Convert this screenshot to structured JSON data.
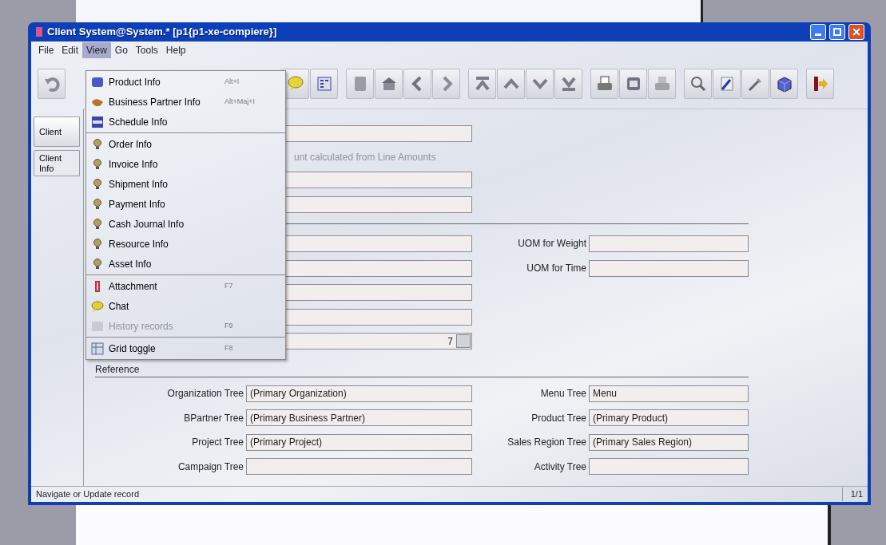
{
  "window": {
    "title": "Client  System@System.* [p1{p1-xe-compiere}]"
  },
  "menu_bar": [
    {
      "label": "File",
      "selected": false
    },
    {
      "label": "Edit",
      "selected": false
    },
    {
      "label": "View",
      "selected": true
    },
    {
      "label": "Go",
      "selected": false
    },
    {
      "label": "Tools",
      "selected": false
    },
    {
      "label": "Help",
      "selected": false
    }
  ],
  "view_menu": [
    {
      "kind": "item",
      "label": "Product Info",
      "shortcut": "Alt+I",
      "disabled": false
    },
    {
      "kind": "item",
      "label": "Business Partner Info",
      "shortcut": "Alt+Maj+I",
      "disabled": false
    },
    {
      "kind": "item",
      "label": "Schedule Info",
      "disabled": false
    },
    {
      "kind": "separator"
    },
    {
      "kind": "item",
      "label": "Order Info",
      "disabled": false
    },
    {
      "kind": "item",
      "label": "Invoice Info",
      "disabled": false
    },
    {
      "kind": "item",
      "label": "Shipment Info",
      "disabled": false
    },
    {
      "kind": "item",
      "label": "Payment Info",
      "disabled": false
    },
    {
      "kind": "item",
      "label": "Cash Journal Info",
      "disabled": false
    },
    {
      "kind": "item",
      "label": "Resource Info",
      "disabled": false
    },
    {
      "kind": "item",
      "label": "Asset Info",
      "disabled": false
    },
    {
      "kind": "separator"
    },
    {
      "kind": "item",
      "label": "Attachment",
      "shortcut": "F7",
      "disabled": false
    },
    {
      "kind": "item",
      "label": "Chat",
      "disabled": false
    },
    {
      "kind": "item",
      "label": "History records",
      "shortcut": "F9",
      "disabled": true
    },
    {
      "kind": "separator"
    },
    {
      "kind": "item",
      "label": "Grid toggle",
      "shortcut": "F8",
      "disabled": false
    }
  ],
  "tabs": [
    {
      "label": "Client",
      "selected": true
    },
    {
      "label": "Client Info",
      "selected": false
    }
  ],
  "upper_rows": [
    {
      "kind": "field"
    },
    {
      "kind": "note",
      "text": "unt calculated from Line Amounts"
    },
    {
      "kind": "field"
    },
    {
      "kind": "field"
    }
  ],
  "lower_rows": [
    {
      "kind": "field",
      "right_label": "UOM for Weight"
    },
    {
      "kind": "field",
      "right_label": "UOM for Time"
    },
    {
      "kind": "field"
    },
    {
      "kind": "field"
    },
    {
      "kind": "lookup",
      "value": "7"
    }
  ],
  "reference": {
    "title": "Reference",
    "rows": [
      {
        "label": "Organization Tree",
        "value": "(Primary Organization)",
        "right_label": "Menu Tree",
        "right_value": "Menu"
      },
      {
        "label": "BPartner Tree",
        "value": "(Primary Business Partner)",
        "right_label": "Product Tree",
        "right_value": "(Primary Product)"
      },
      {
        "label": "Project Tree",
        "value": "(Primary Project)",
        "right_label": "Sales Region Tree",
        "right_value": "(Primary Sales Region)"
      },
      {
        "label": "Campaign Tree",
        "right_label": "Activity Tree"
      }
    ]
  },
  "status_bar": {
    "message": "Navigate or Update record",
    "record": "1/1"
  }
}
